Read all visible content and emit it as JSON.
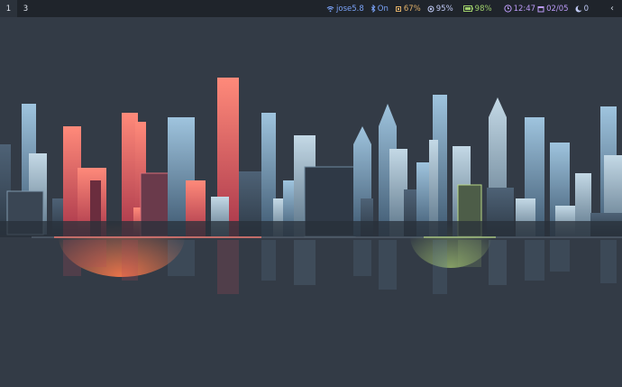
{
  "workspaces": [
    {
      "label": "1",
      "active": true
    },
    {
      "label": "3",
      "active": false
    }
  ],
  "status": {
    "wifi": {
      "icon": "wifi-icon",
      "text": "jose5.8",
      "color": "#7aa2f7"
    },
    "bluetooth": {
      "icon": "bluetooth-icon",
      "text": "On",
      "color": "#7aa2f7"
    },
    "cpu": {
      "icon": "cpu-icon",
      "text": "67%",
      "color": "#e0af68"
    },
    "memory": {
      "icon": "memory-icon",
      "text": "95%",
      "color": "#c0caf5"
    },
    "battery": {
      "icon": "battery-icon",
      "text": "98%",
      "color": "#9ece6a"
    },
    "time": {
      "icon": "clock-icon",
      "text": "12:47",
      "color": "#bb9af7"
    },
    "date": {
      "icon": "calendar-icon",
      "text": "02/05",
      "color": "#bb9af7"
    },
    "notifications": {
      "icon": "moon-icon",
      "text": "0",
      "color": "#c0caf5"
    },
    "tray_toggle": {
      "icon": "chevron-left-icon",
      "text": "‹"
    }
  },
  "wallpaper": {
    "icon": "city-skyline-wallpaper"
  }
}
